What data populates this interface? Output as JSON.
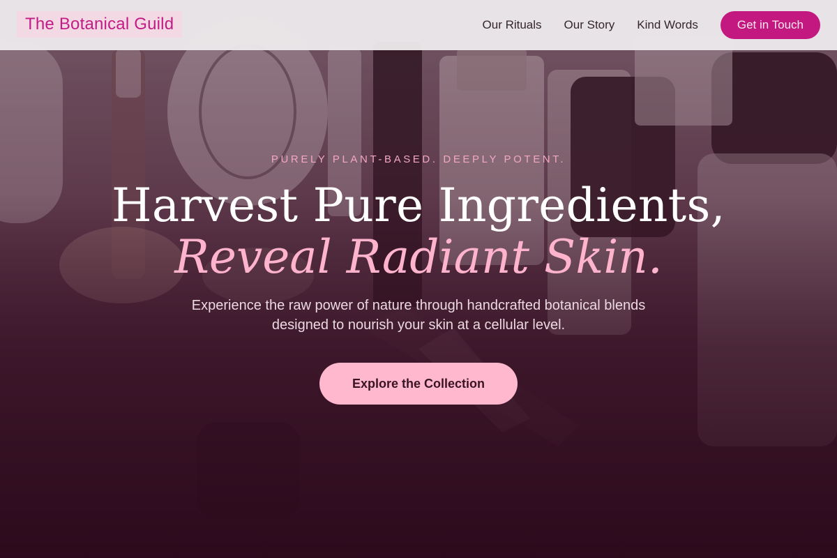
{
  "header": {
    "brand": "The Botanical Guild",
    "nav": [
      {
        "label": "Our Rituals"
      },
      {
        "label": "Our Story"
      },
      {
        "label": "Kind Words"
      }
    ],
    "cta_label": "Get in Touch"
  },
  "hero": {
    "eyebrow": "PURELY PLANT-BASED. DEEPLY POTENT.",
    "headline_line1": "Harvest Pure Ingredients,",
    "headline_line2": "Reveal Radiant Skin.",
    "subtext": "Experience the raw power of nature through handcrafted botanical blends designed to nourish your skin at a cellular level.",
    "button_label": "Explore the Collection",
    "background_image": "cosmetics-products-photo"
  },
  "colors": {
    "brand": "#c21c86",
    "brand_bg": "#f3d9e3",
    "cta_bg": "#c2187f",
    "headline_accent": "#ffb3cc",
    "eyebrow": "#f3a7c1",
    "button_bg": "#ffb8cd",
    "overlay_dark": "#2c0a1c"
  }
}
